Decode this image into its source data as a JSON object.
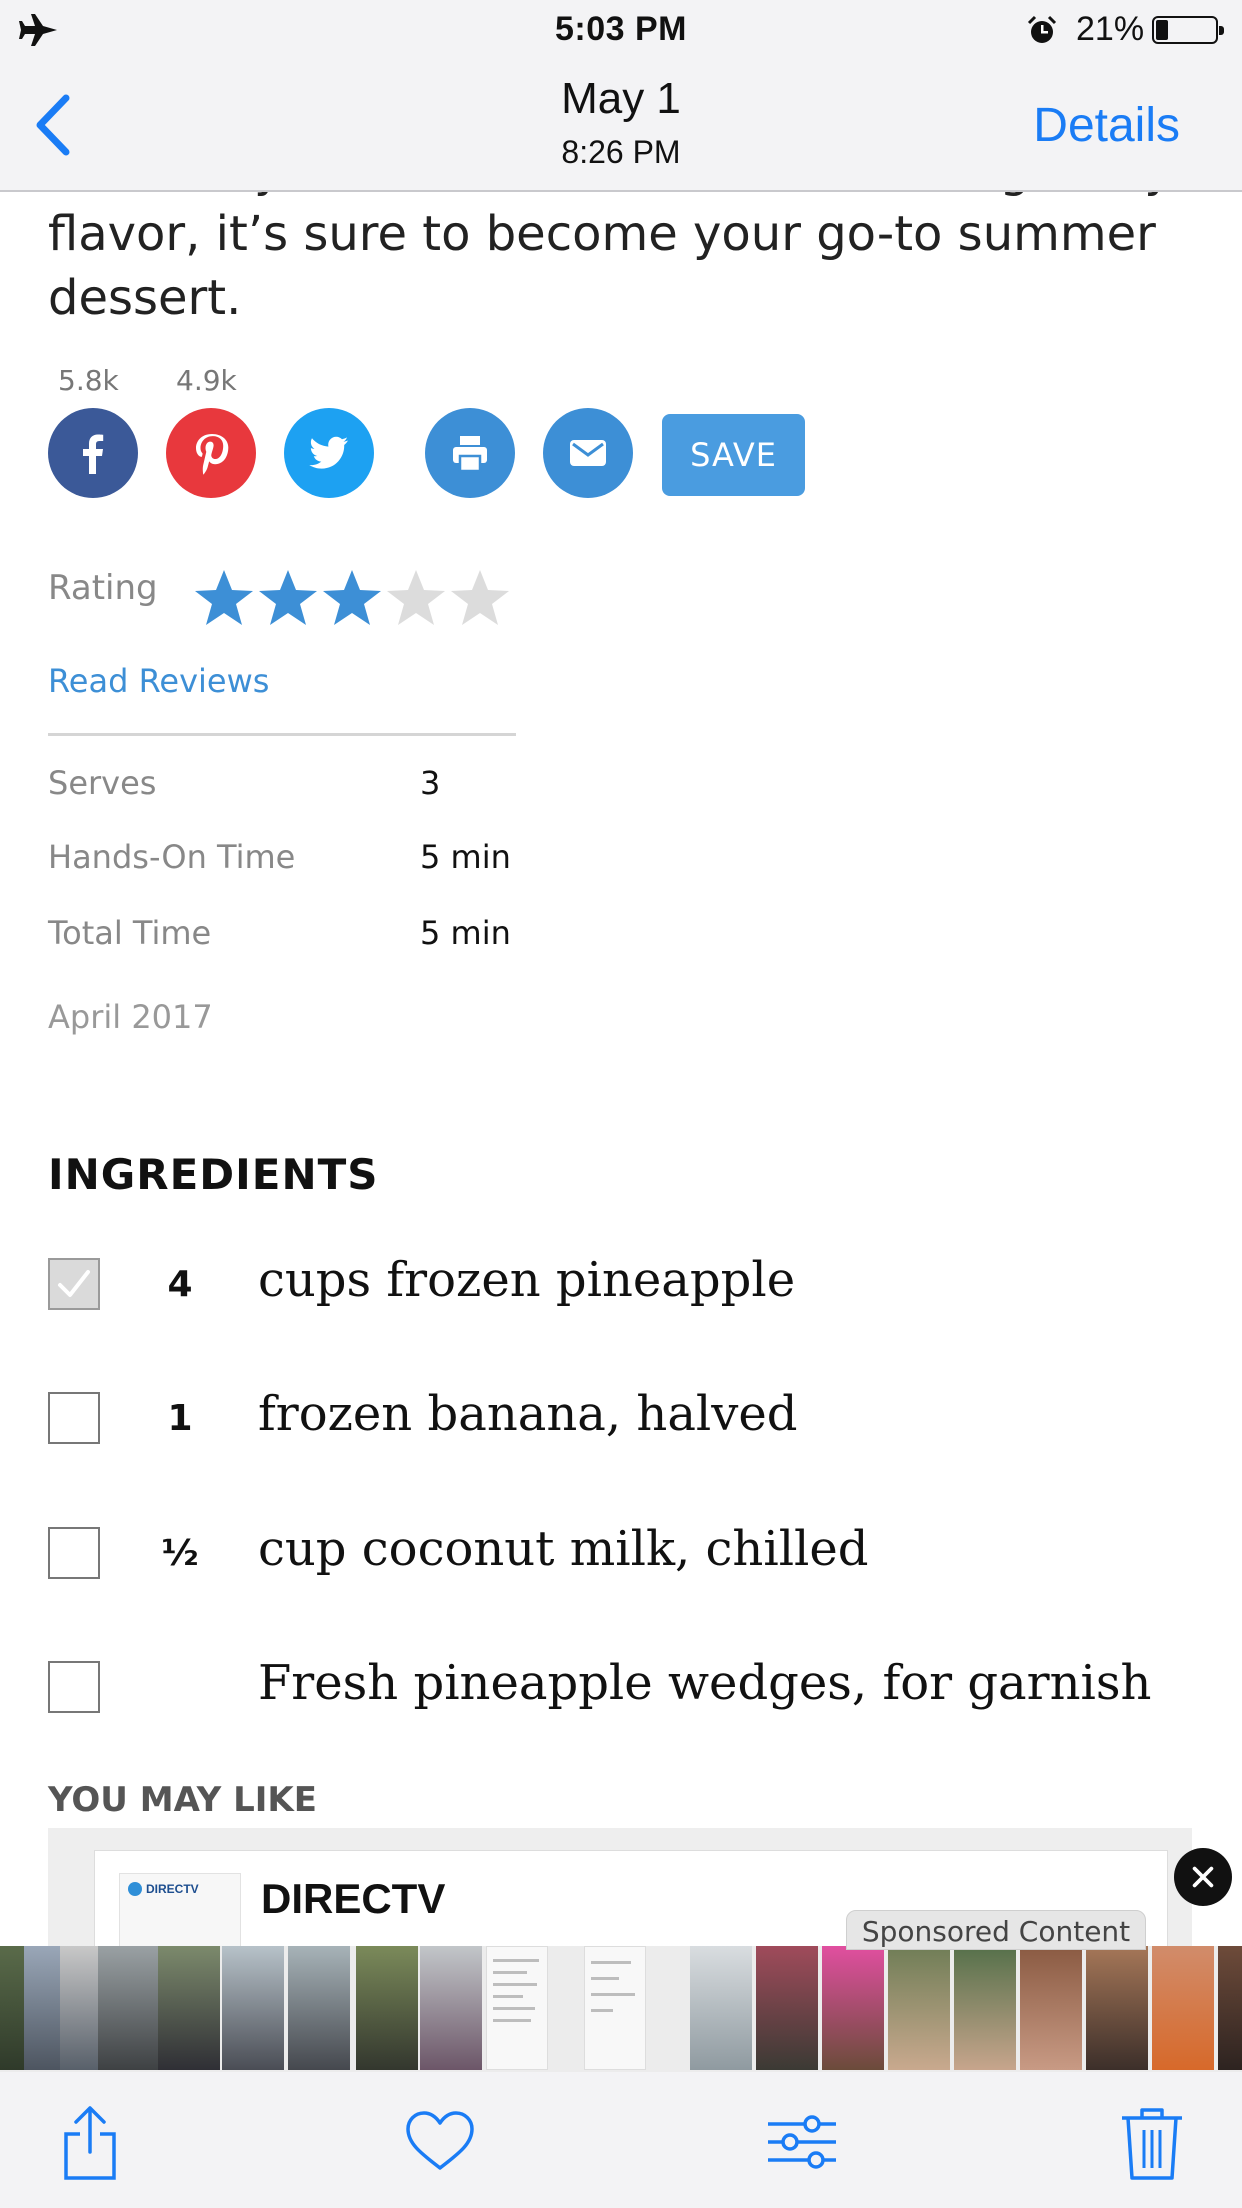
{
  "status_bar": {
    "time": "5:03 PM",
    "battery_percent": "21%",
    "battery_level": 0.21,
    "icons": [
      "airplane-icon",
      "alarm-icon",
      "battery-icon"
    ]
  },
  "nav": {
    "title": "May 1",
    "subtitle": "8:26 PM",
    "details_label": "Details",
    "back_icon": "chevron-left-icon"
  },
  "article": {
    "intro_text": "incredibly smooth texture and refreshing fruity flavor, it’s sure to become your go-to summer dessert.",
    "share": {
      "facebook_count": "5.8k",
      "pinterest_count": "4.9k",
      "buttons": [
        "facebook-icon",
        "pinterest-icon",
        "twitter-icon",
        "print-icon",
        "email-icon"
      ],
      "save_label": "SAVE",
      "colors": {
        "facebook": "#3b5998",
        "pinterest": "#e8383d",
        "twitter": "#1da1f2",
        "print": "#3d8fd6",
        "email": "#3d8fd6",
        "save": "#4a9ce0"
      }
    },
    "rating": {
      "label": "Rating",
      "value": 3,
      "max": 5,
      "star_color": "#3d8fd6",
      "empty_color": "#dcdcdc"
    },
    "read_reviews_label": "Read Reviews",
    "meta": [
      {
        "label": "Serves",
        "value": "3"
      },
      {
        "label": "Hands-On Time",
        "value": "5 min"
      },
      {
        "label": "Total Time",
        "value": "5 min"
      }
    ],
    "date": "April 2017",
    "ingredients_heading": "INGREDIENTS",
    "ingredients": [
      {
        "qty": "4",
        "text": "cups frozen pineapple",
        "checked": true
      },
      {
        "qty": "1",
        "text": "frozen banana, halved",
        "checked": false
      },
      {
        "qty": "½",
        "text": "cup coconut milk, chilled",
        "checked": false
      },
      {
        "qty": "",
        "text": "Fresh pineapple wedges, for garnish",
        "checked": false
      }
    ],
    "you_may_like_label": "YOU MAY LIKE",
    "ad": {
      "title": "DIRECTV",
      "logo_text": "DIRECTV",
      "sponsored_label": "Sponsored Content"
    }
  },
  "toolbar": {
    "icons": [
      "share-icon",
      "heart-icon",
      "adjust-icon",
      "trash-icon"
    ]
  },
  "accent_color": "#1a7cf5"
}
